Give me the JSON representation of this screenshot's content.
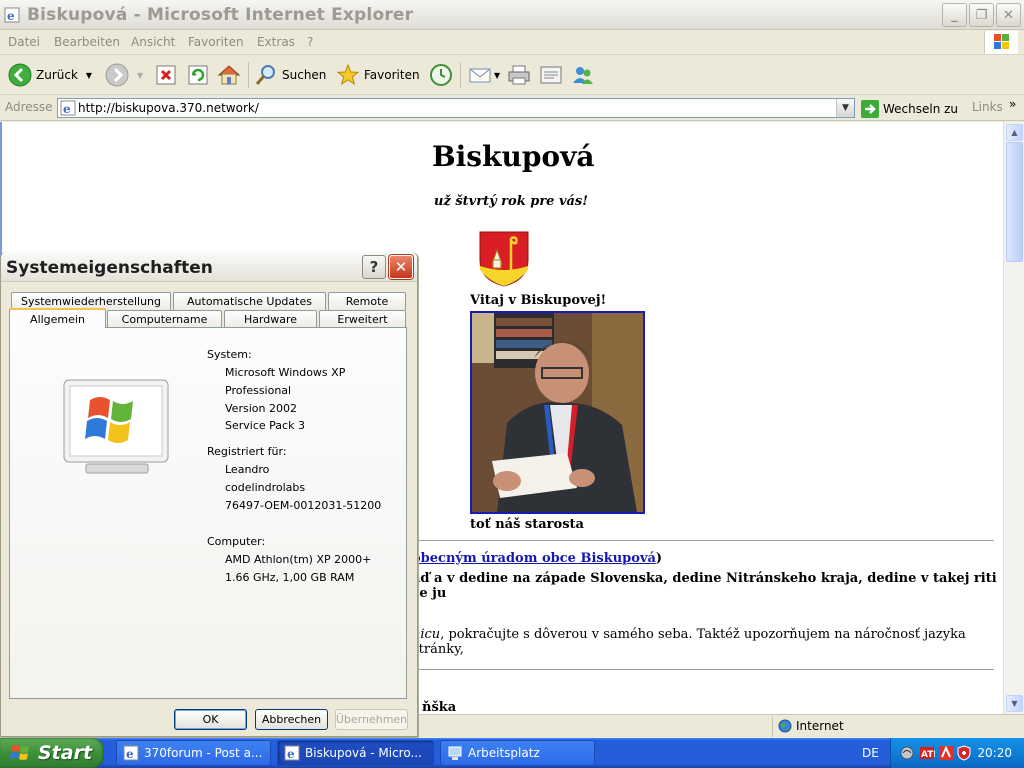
{
  "ie": {
    "title": "Biskupová - Microsoft Internet Explorer",
    "menu": [
      "Datei",
      "Bearbeiten",
      "Ansicht",
      "Favoriten",
      "Extras",
      "?"
    ],
    "toolbar": {
      "back": "Zurück",
      "search": "Suchen",
      "favorites": "Favoriten"
    },
    "address": {
      "label": "Adresse",
      "url": "http://biskupova.370.network/",
      "go": "Wechseln zu",
      "links": "Links",
      "links_chevron": "»"
    },
    "status": {
      "zone": "Internet"
    }
  },
  "page": {
    "title": "Biskupová",
    "slogan": "už štvrtý rok pre vás!",
    "welcome": "Vitaj v Biskupovej!",
    "photo_caption": "toť náš starosta",
    "link_text": "obecným úradom obce Biskupová",
    "link_close": ")",
    "body_line1": "áď a v dedine na západe Slovenska, dedine Nitránskeho kraja, dedine v takej riti že ju",
    "body_italic": "nicu",
    "body_line2": ", pokračujte s dôverou v samého seba. Taktéž upozorňujem na náročnosť jazyka stránky,",
    "fragment": "ňška"
  },
  "dialog": {
    "title": "Systemeigenschaften",
    "help": "?",
    "close": "✕",
    "tabs_top": [
      "Systemwiederherstellung",
      "Automatische Updates",
      "Remote"
    ],
    "tabs_bottom": [
      "Allgemein",
      "Computername",
      "Hardware",
      "Erweitert"
    ],
    "system_label": "System:",
    "system": [
      "Microsoft Windows XP",
      "Professional",
      "Version 2002",
      "Service Pack 3"
    ],
    "registered_label": "Registriert für:",
    "registered": [
      "Leandro",
      "codelindrolabs",
      "76497-OEM-0012031-51200"
    ],
    "computer_label": "Computer:",
    "computer": [
      "AMD Athlon(tm) XP 2000+",
      "1.66 GHz, 1,00 GB RAM"
    ],
    "buttons": {
      "ok": "OK",
      "cancel": "Abbrechen",
      "apply": "Übernehmen"
    }
  },
  "taskbar": {
    "start": "Start",
    "tasks": [
      "370forum - Post a...",
      "Biskupová - Micro...",
      "Arbeitsplatz"
    ],
    "lang": "DE",
    "clock": "20:20"
  }
}
